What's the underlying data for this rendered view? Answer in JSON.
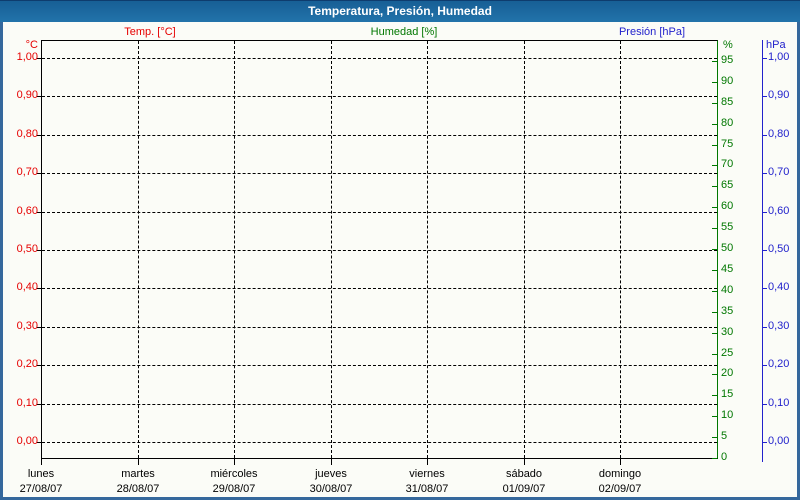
{
  "window": {
    "title": "Temperatura, Presión, Humedad"
  },
  "legend": {
    "items": [
      {
        "label": "Temp. [°C]",
        "color": "#e60000"
      },
      {
        "label": "Humedad [%]",
        "color": "#007700"
      },
      {
        "label": "Presión [hPa]",
        "color": "#2222cc"
      }
    ]
  },
  "axes": {
    "temp": {
      "unit": "°C",
      "color": "#e60000",
      "side": "left",
      "ticks": [
        {
          "value": 1.0,
          "label": "1,00"
        },
        {
          "value": 0.9,
          "label": "0,90"
        },
        {
          "value": 0.8,
          "label": "0,80"
        },
        {
          "value": 0.7,
          "label": "0,70"
        },
        {
          "value": 0.6,
          "label": "0,60"
        },
        {
          "value": 0.5,
          "label": "0,50"
        },
        {
          "value": 0.4,
          "label": "0,40"
        },
        {
          "value": 0.3,
          "label": "0,30"
        },
        {
          "value": 0.2,
          "label": "0,20"
        },
        {
          "value": 0.1,
          "label": "0,10"
        },
        {
          "value": 0.0,
          "label": "0,00"
        }
      ]
    },
    "humidity": {
      "unit": "%",
      "color": "#007700",
      "side": "right-inner",
      "ticks": [
        {
          "value": 95,
          "label": "95"
        },
        {
          "value": 90,
          "label": "90"
        },
        {
          "value": 85,
          "label": "85"
        },
        {
          "value": 80,
          "label": "80"
        },
        {
          "value": 75,
          "label": "75"
        },
        {
          "value": 70,
          "label": "70"
        },
        {
          "value": 65,
          "label": "65"
        },
        {
          "value": 60,
          "label": "60"
        },
        {
          "value": 55,
          "label": "55"
        },
        {
          "value": 50,
          "label": "50"
        },
        {
          "value": 45,
          "label": "45"
        },
        {
          "value": 40,
          "label": "40"
        },
        {
          "value": 35,
          "label": "35"
        },
        {
          "value": 30,
          "label": "30"
        },
        {
          "value": 25,
          "label": "25"
        },
        {
          "value": 20,
          "label": "20"
        },
        {
          "value": 15,
          "label": "15"
        },
        {
          "value": 10,
          "label": "10"
        },
        {
          "value": 5,
          "label": "5"
        },
        {
          "value": 0,
          "label": "0"
        }
      ]
    },
    "pressure": {
      "unit": "hPa",
      "color": "#2222cc",
      "side": "right-outer",
      "ticks": [
        {
          "value": 1.0,
          "label": "1,00"
        },
        {
          "value": 0.9,
          "label": "0,90"
        },
        {
          "value": 0.8,
          "label": "0,80"
        },
        {
          "value": 0.7,
          "label": "0,70"
        },
        {
          "value": 0.6,
          "label": "0,60"
        },
        {
          "value": 0.5,
          "label": "0,50"
        },
        {
          "value": 0.4,
          "label": "0,40"
        },
        {
          "value": 0.3,
          "label": "0,30"
        },
        {
          "value": 0.2,
          "label": "0,20"
        },
        {
          "value": 0.1,
          "label": "0,10"
        },
        {
          "value": 0.0,
          "label": "0,00"
        }
      ]
    },
    "x": {
      "days": [
        {
          "day": "lunes",
          "date": "27/08/07"
        },
        {
          "day": "martes",
          "date": "28/08/07"
        },
        {
          "day": "miércoles",
          "date": "29/08/07"
        },
        {
          "day": "jueves",
          "date": "30/08/07"
        },
        {
          "day": "viernes",
          "date": "31/08/07"
        },
        {
          "day": "sábado",
          "date": "01/09/07"
        },
        {
          "day": "domingo",
          "date": "02/09/07"
        }
      ]
    }
  },
  "chart_data": {
    "type": "line",
    "title": "Temperatura, Presión, Humedad",
    "categories": [
      "27/08/07",
      "28/08/07",
      "29/08/07",
      "30/08/07",
      "31/08/07",
      "01/09/07",
      "02/09/07"
    ],
    "category_day_names": [
      "lunes",
      "martes",
      "miércoles",
      "jueves",
      "viernes",
      "sábado",
      "domingo"
    ],
    "series": [
      {
        "name": "Temp. [°C]",
        "axis": "°C",
        "color": "#e60000",
        "values": []
      },
      {
        "name": "Humedad [%]",
        "axis": "%",
        "color": "#007700",
        "values": []
      },
      {
        "name": "Presión [hPa]",
        "axis": "hPa",
        "color": "#2222cc",
        "values": []
      }
    ],
    "axis_temp": {
      "label": "°C",
      "range": [
        0,
        1
      ],
      "tick_step": 0.1,
      "position": "left"
    },
    "axis_humidity": {
      "label": "%",
      "range": [
        0,
        100
      ],
      "tick_step": 5,
      "position": "right"
    },
    "axis_pressure": {
      "label": "hPa",
      "range": [
        0,
        1
      ],
      "tick_step": 0.1,
      "position": "right-outer"
    },
    "grid": "dashed",
    "legend_position": "top"
  }
}
